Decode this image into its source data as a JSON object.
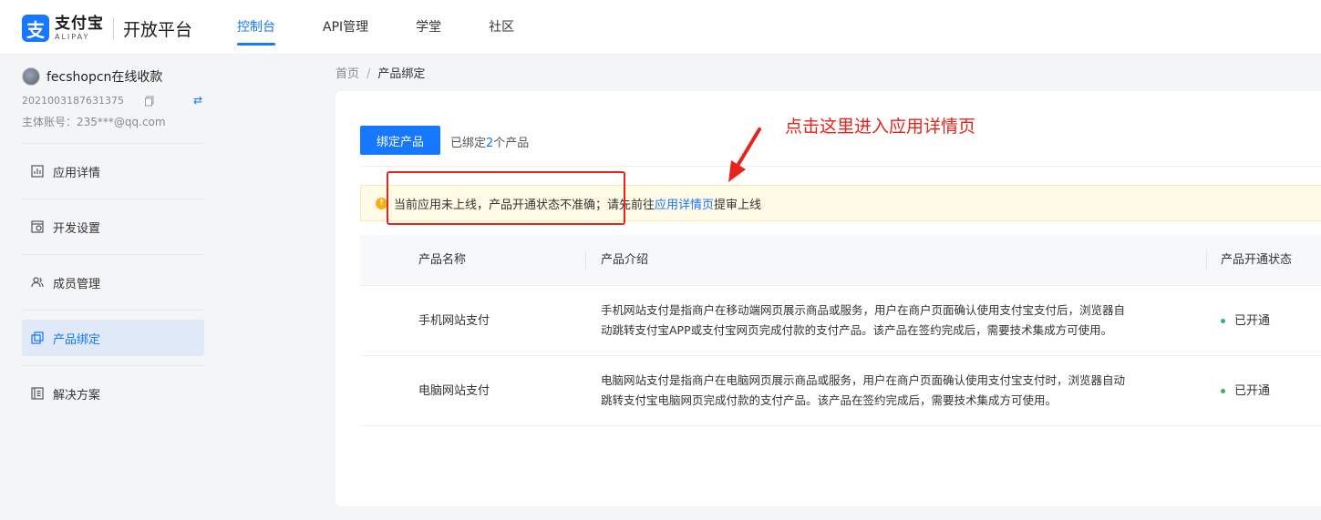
{
  "brand": {
    "mark": "支",
    "name_cn": "支付宝",
    "name_en": "ALIPAY",
    "platform": "开放平台"
  },
  "nav": [
    {
      "label": "控制台",
      "active": true
    },
    {
      "label": "API管理",
      "active": false
    },
    {
      "label": "学堂",
      "active": false
    },
    {
      "label": "社区",
      "active": false
    }
  ],
  "sidebar": {
    "app_name": "fecshopcn在线收款",
    "app_id": "2021003187631375",
    "account": "主体账号：235***@qq.com",
    "items": [
      {
        "label": "应用详情",
        "icon": "app-detail-icon"
      },
      {
        "label": "开发设置",
        "icon": "dev-settings-icon"
      },
      {
        "label": "成员管理",
        "icon": "members-icon"
      },
      {
        "label": "产品绑定",
        "icon": "product-bind-icon",
        "active": true
      },
      {
        "label": "解决方案",
        "icon": "solution-icon"
      }
    ]
  },
  "breadcrumb": {
    "home": "首页",
    "separator": "/",
    "current": "产品绑定"
  },
  "main": {
    "bind_button": "绑定产品",
    "bound_prefix": "已绑定",
    "bound_count": "2",
    "bound_suffix": "个产品",
    "alert": {
      "text1": "当前应用未上线，产品开通状态不准确；请先前往",
      "link": "应用详情页",
      "text2": "提审上线"
    },
    "table": {
      "headers": [
        "产品名称",
        "产品介绍",
        "产品开通状态"
      ],
      "rows": [
        {
          "name": "手机网站支付",
          "desc_line1": "手机网站支付是指商户在移动端网页展示商品或服务，用户在商户页面确认使用支付宝支付后，浏览器自",
          "desc_line2": "动跳转支付宝APP或支付宝网页完成付款的支付产品。该产品在签约完成后，需要技术集成方可使用。",
          "status": "已开通"
        },
        {
          "name": "电脑网站支付",
          "desc_line1": "电脑网站支付是指商户在电脑网页展示商品或服务，用户在商户页面确认使用支付宝支付时，浏览器自动",
          "desc_line2": "跳转支付宝电脑网页完成付款的支付产品。该产品在签约完成后，需要技术集成方可使用。",
          "status": "已开通"
        }
      ]
    }
  },
  "annotation": {
    "text": "点击这里进入应用详情页",
    "color": "#e8231b"
  },
  "colors": {
    "accent": "#1677ff",
    "success": "#2fb36f",
    "warning": "#faad14"
  }
}
